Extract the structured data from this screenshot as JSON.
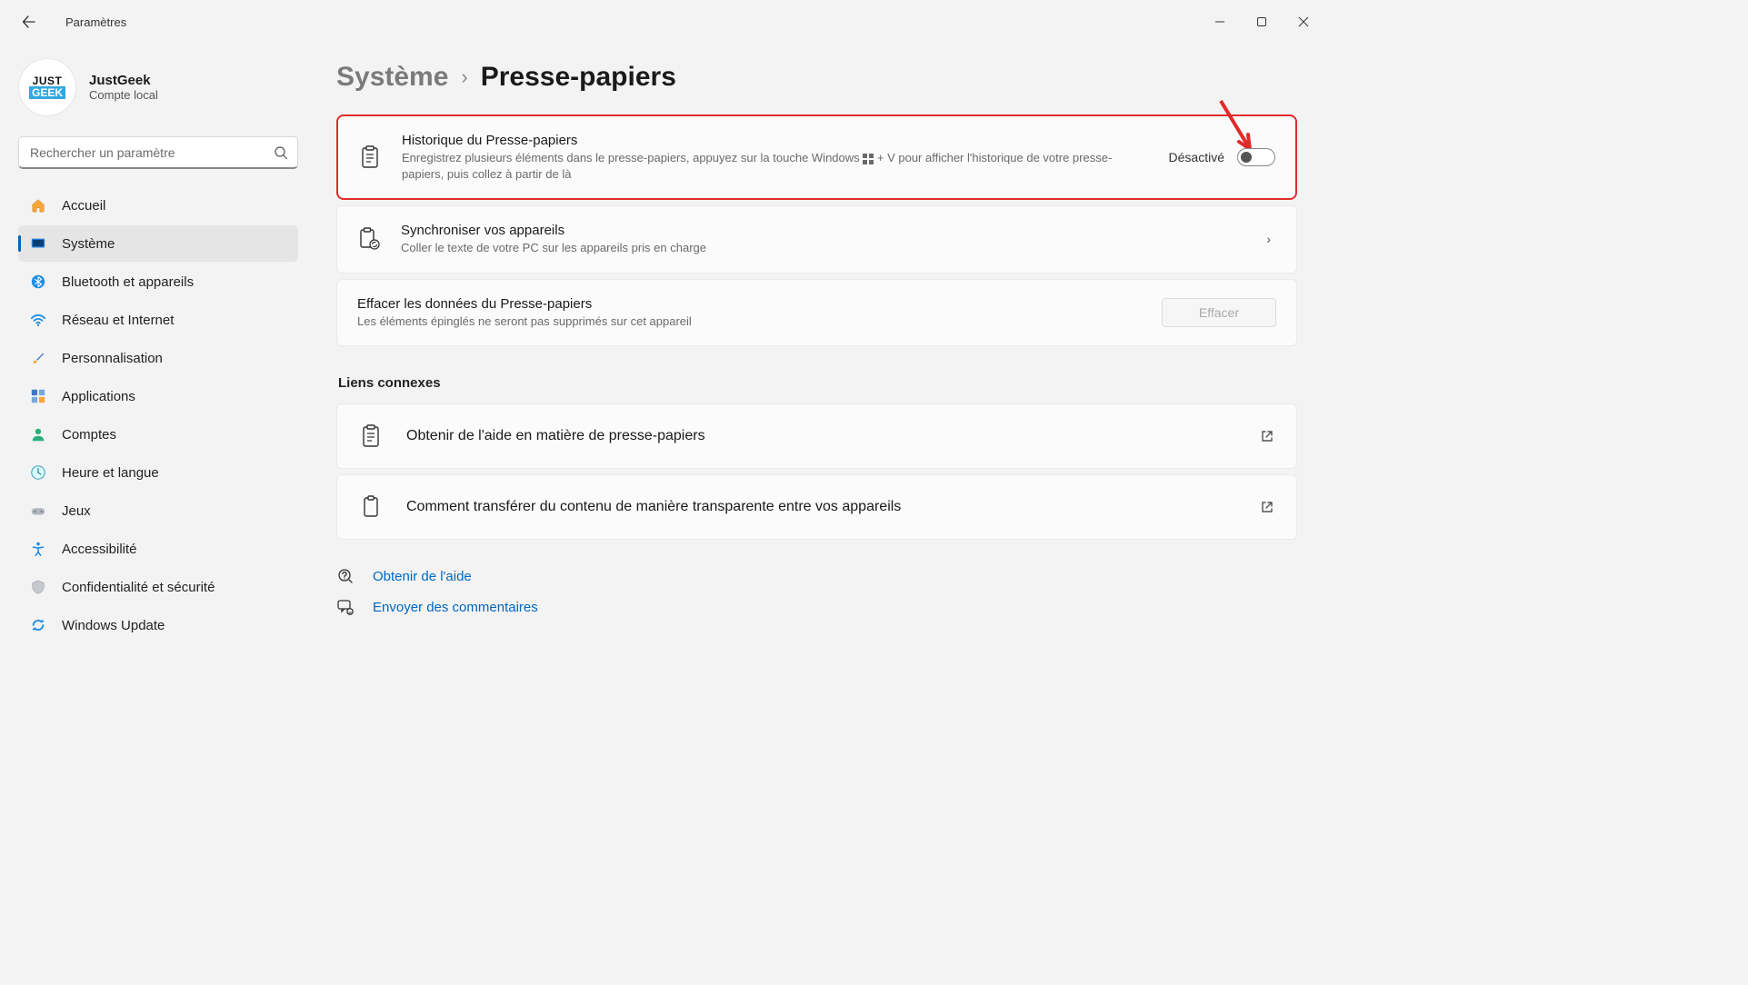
{
  "app": {
    "title": "Paramètres"
  },
  "account": {
    "name": "JustGeek",
    "sub": "Compte local"
  },
  "search": {
    "placeholder": "Rechercher un paramètre"
  },
  "nav": {
    "home": "Accueil",
    "system": "Système",
    "bluetooth": "Bluetooth et appareils",
    "network": "Réseau et Internet",
    "personalization": "Personnalisation",
    "apps": "Applications",
    "accounts": "Comptes",
    "time": "Heure et langue",
    "gaming": "Jeux",
    "accessibility": "Accessibilité",
    "privacy": "Confidentialité et sécurité",
    "update": "Windows Update"
  },
  "breadcrumb": {
    "parent": "Système",
    "current": "Presse-papiers"
  },
  "cards": {
    "history": {
      "title": "Historique du Presse-papiers",
      "desc_pre": "Enregistrez plusieurs éléments dans le presse-papiers, appuyez sur la touche Windows ",
      "desc_post": " + V pour afficher l'historique de votre presse-papiers, puis collez à partir de là",
      "state": "Désactivé"
    },
    "sync": {
      "title": "Synchroniser vos appareils",
      "desc": "Coller le texte de votre PC sur les appareils pris en charge"
    },
    "clear": {
      "title": "Effacer les données du Presse-papiers",
      "desc": "Les éléments épinglés ne seront pas supprimés sur cet appareil",
      "button": "Effacer"
    }
  },
  "relatedTitle": "Liens connexes",
  "related": {
    "help": "Obtenir de l'aide en matière de presse-papiers",
    "transfer": "Comment transférer du contenu de manière transparente entre vos appareils"
  },
  "footer": {
    "help": "Obtenir de l'aide",
    "feedback": "Envoyer des commentaires"
  }
}
